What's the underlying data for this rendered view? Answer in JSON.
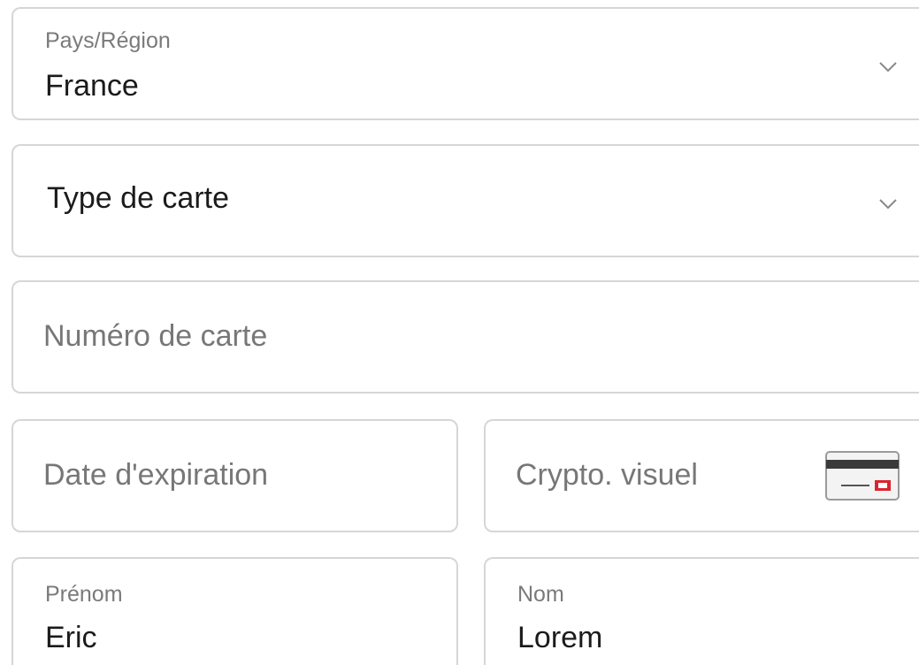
{
  "country_select": {
    "label": "Pays/Région",
    "value": "France",
    "icon": "chevron-down-icon"
  },
  "card_type_select": {
    "placeholder": "Type de carte",
    "icon": "chevron-down-icon"
  },
  "card_number": {
    "placeholder": "Numéro de carte"
  },
  "expiration_date": {
    "placeholder": "Date d'expiration"
  },
  "security_code": {
    "placeholder": "Crypto. visuel",
    "icon": "card-security-code-icon"
  },
  "first_name": {
    "label": "Prénom",
    "value": "Eric"
  },
  "last_name": {
    "label": "Nom",
    "value": "Lorem"
  },
  "colors": {
    "border": "#d6d6d6",
    "label": "#7a7a7a",
    "text": "#1b1b1b",
    "placeholder": "#777777",
    "card_accent": "#d9262c"
  }
}
